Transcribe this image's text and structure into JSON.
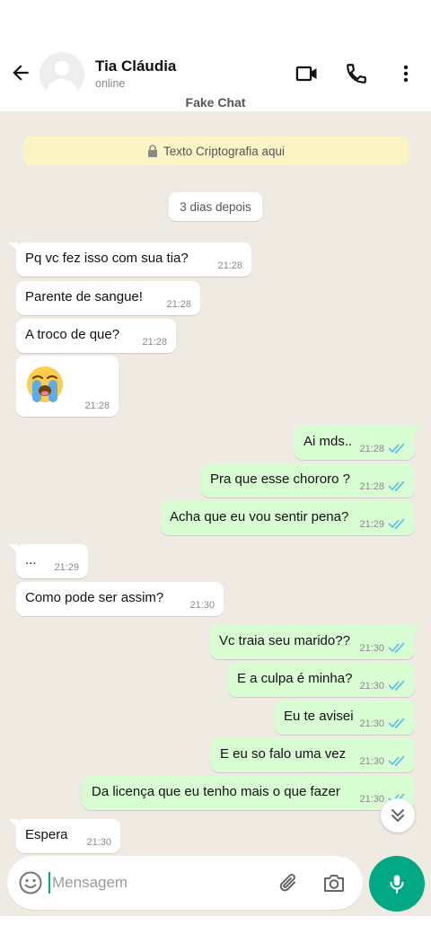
{
  "header": {
    "contact_name": "Tia Cláudia",
    "status": "online",
    "subtitle": "Fake Chat",
    "icons": [
      "back-arrow-icon",
      "avatar-placeholder",
      "video-call-icon",
      "phone-icon",
      "more-vert-icon"
    ]
  },
  "chat": {
    "encryption_text": "Texto Criptografia aqui",
    "day_label": "3 dias depois",
    "messages": [
      {
        "dir": "in",
        "text": "Pq vc fez isso com sua tia?",
        "time": "21:28"
      },
      {
        "dir": "in",
        "text": "Parente de sangue!",
        "time": "21:28"
      },
      {
        "dir": "in",
        "text": "A troco de que?",
        "time": "21:28"
      },
      {
        "dir": "in",
        "text": "",
        "emoji": "loudly-crying-face",
        "time": "21:28"
      },
      {
        "dir": "out",
        "text": "Ai mds..",
        "time": "21:28",
        "status": "read"
      },
      {
        "dir": "out",
        "text": "Pra que esse chororo ?",
        "time": "21:28",
        "status": "read"
      },
      {
        "dir": "out",
        "text": "Acha que eu vou sentir pena?",
        "time": "21:29",
        "status": "read"
      },
      {
        "dir": "in",
        "text": "...",
        "time": "21:29"
      },
      {
        "dir": "in",
        "text": "Como pode ser assim?",
        "time": "21:30"
      },
      {
        "dir": "out",
        "text": "Vc traia seu marido??",
        "time": "21:30",
        "status": "read"
      },
      {
        "dir": "out",
        "text": "E a culpa é minha?",
        "time": "21:30",
        "status": "read"
      },
      {
        "dir": "out",
        "text": "Eu te avisei",
        "time": "21:30",
        "status": "read"
      },
      {
        "dir": "out",
        "text": "E eu so falo uma vez",
        "time": "21:30",
        "status": "read"
      },
      {
        "dir": "out",
        "text": "Da licença que eu tenho mais o que fazer",
        "time": "21:30",
        "status": "read"
      },
      {
        "dir": "in",
        "text": "Espera",
        "time": "21:30"
      }
    ]
  },
  "composer": {
    "placeholder": "Mensagem",
    "icons": [
      "emoji-icon",
      "attach-icon",
      "camera-icon",
      "mic-icon"
    ]
  },
  "colors": {
    "accent": "#00a884",
    "outgoing_bubble": "#d9fdd3",
    "incoming_bubble": "#ffffff",
    "chat_background": "#efeae2",
    "encryption_banner": "#fcf4c4",
    "read_ticks": "#53bdeb"
  }
}
